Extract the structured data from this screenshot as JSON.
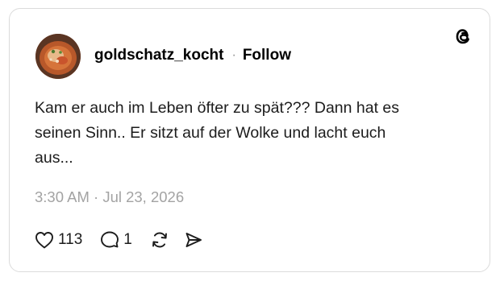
{
  "post": {
    "username": "goldschatz_kocht",
    "separator": "·",
    "follow_label": "Follow",
    "text": "Kam er auch im Leben öfter zu spät??? Dann hat es\nseinen Sinn.. Er sitzt auf der Wolke und lacht euch\naus...",
    "timestamp": "3:30 AM · Jul 23, 2026",
    "avatar": "food-dish-photo"
  },
  "actions": {
    "like_count": "113",
    "reply_count": "1"
  },
  "icons": {
    "brand": "threads-logo-icon",
    "like": "heart-icon",
    "reply": "comment-bubble-icon",
    "repost": "repost-icon",
    "share": "send-icon"
  },
  "colors": {
    "text": "#1c1c1c",
    "muted": "#a3a3a3",
    "border": "#dbdbdb"
  }
}
